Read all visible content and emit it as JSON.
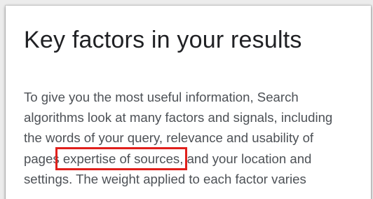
{
  "heading": "Key factors in your results",
  "paragraph": {
    "lines": [
      "To give you the most useful information, Search",
      "algorithms look at many factors and signals, including",
      "the words of your query, relevance and usability of"
    ],
    "line4_before": "pages",
    "line4_highlight": " expertise of sources,",
    "line4_after": " and your location and",
    "line5": "settings. The weight applied to each factor varies"
  },
  "highlight_color": "#e0201c"
}
